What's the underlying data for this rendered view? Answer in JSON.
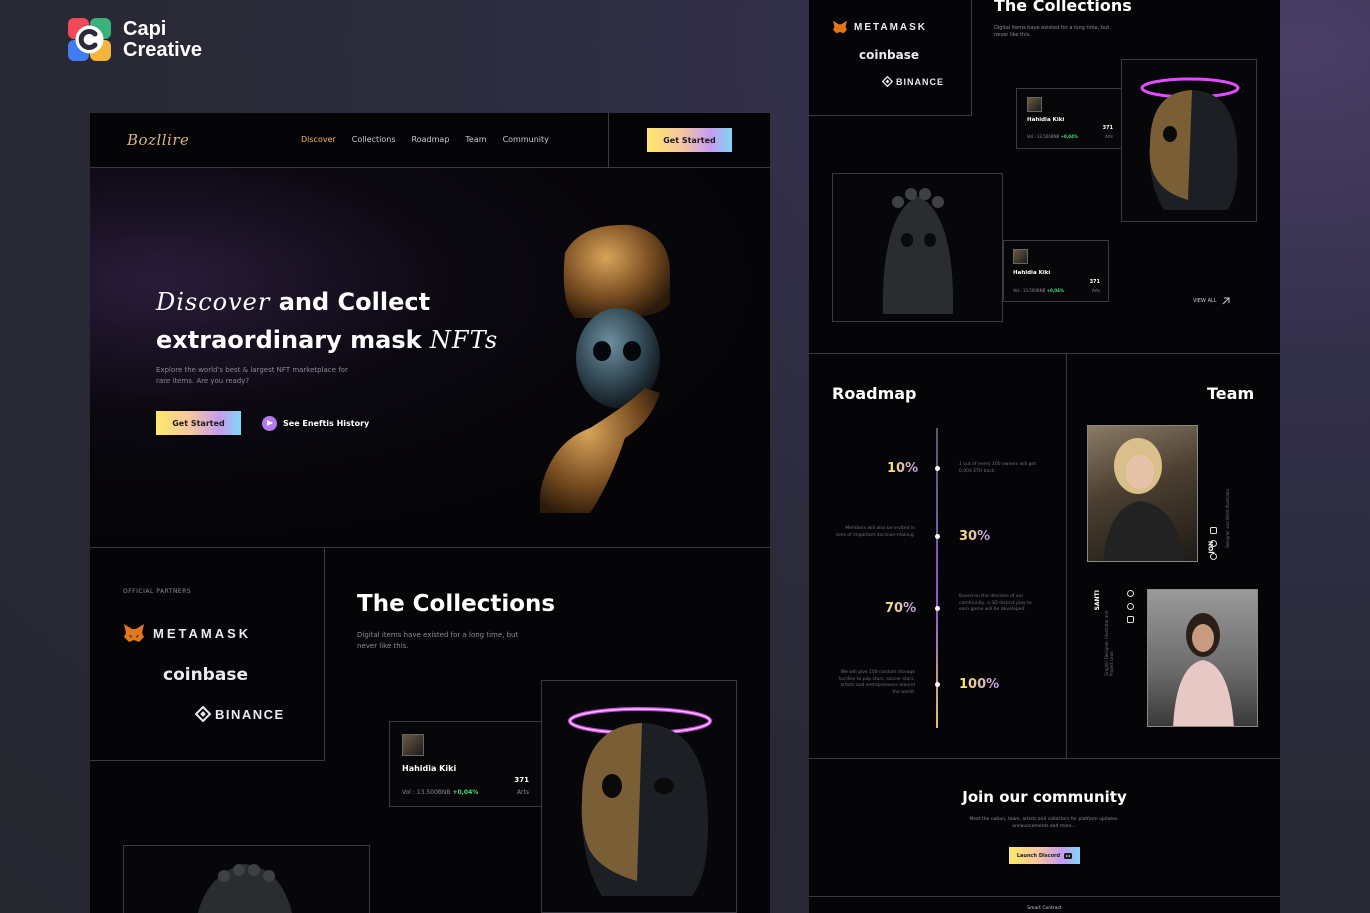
{
  "brand": {
    "line1": "Capi",
    "line2": "Creative"
  },
  "nav": {
    "logo": "Bozllire",
    "links": [
      "Discover",
      "Collections",
      "Roadmap",
      "Team",
      "Community"
    ],
    "cta": "Get Started"
  },
  "hero": {
    "title_script1": "Discover",
    "title_part1": " and Collect",
    "title_part2": "extraordinary mask ",
    "title_script2": "NFTs",
    "subtitle": "Explore the world's best & largest NFT marketplace for rare items. Are you ready?",
    "cta": "Get Started",
    "link": "See Eneftis History"
  },
  "partners": {
    "label": "OFFICIAL PARTNERS",
    "metamask": "METAMASK",
    "coinbase": "coinbase",
    "binance": "BINANCE"
  },
  "collections": {
    "title": "The Collections",
    "subtitle": "Digital items have existed for a long time, but never like this.",
    "card": {
      "name": "Hahidia Kiki",
      "vol_label": "Vol : 13.500BNB",
      "change": "+0,04%",
      "count": "371",
      "unit": "Arts"
    },
    "view_all": "VIEW ALL"
  },
  "roadmap": {
    "title": "Roadmap",
    "milestones": [
      {
        "percent": "10%",
        "text": "1 out of every 100 owners will get 0,004 ETH back."
      },
      {
        "percent": "30%",
        "text": "Members will also be invited in tons of important decision-making."
      },
      {
        "percent": "70%",
        "text": "Based on the decision of our community, a 3D district play to earn game will be developed."
      },
      {
        "percent": "100%",
        "text": "We will give 100 random storage hurdles to pop stars, soccer stars, artists and entrepreneurs around the world."
      }
    ]
  },
  "team": {
    "title": "Team",
    "members": [
      {
        "name": "JON",
        "role": "Designer and Artist Illustrator"
      },
      {
        "name": "SANTI",
        "role": "Graphic Designer, Illustrator and Project Lead"
      }
    ]
  },
  "community": {
    "title": "Join our community",
    "subtitle": "Meet the nation, team, artists and collectors for platform updates, announcements and more...",
    "button": "Launch Discord"
  },
  "footer_peek": "Smart Contract",
  "colors": {
    "accent_orange": "#f4b86a",
    "accent_purple": "#b27bf0",
    "positive": "#45e07a"
  },
  "icons": [
    "capi-logo-icon",
    "play-icon",
    "metamask-fox-icon",
    "binance-diamond-icon",
    "arrow-up-right-icon",
    "discord-icon",
    "social-icon"
  ]
}
